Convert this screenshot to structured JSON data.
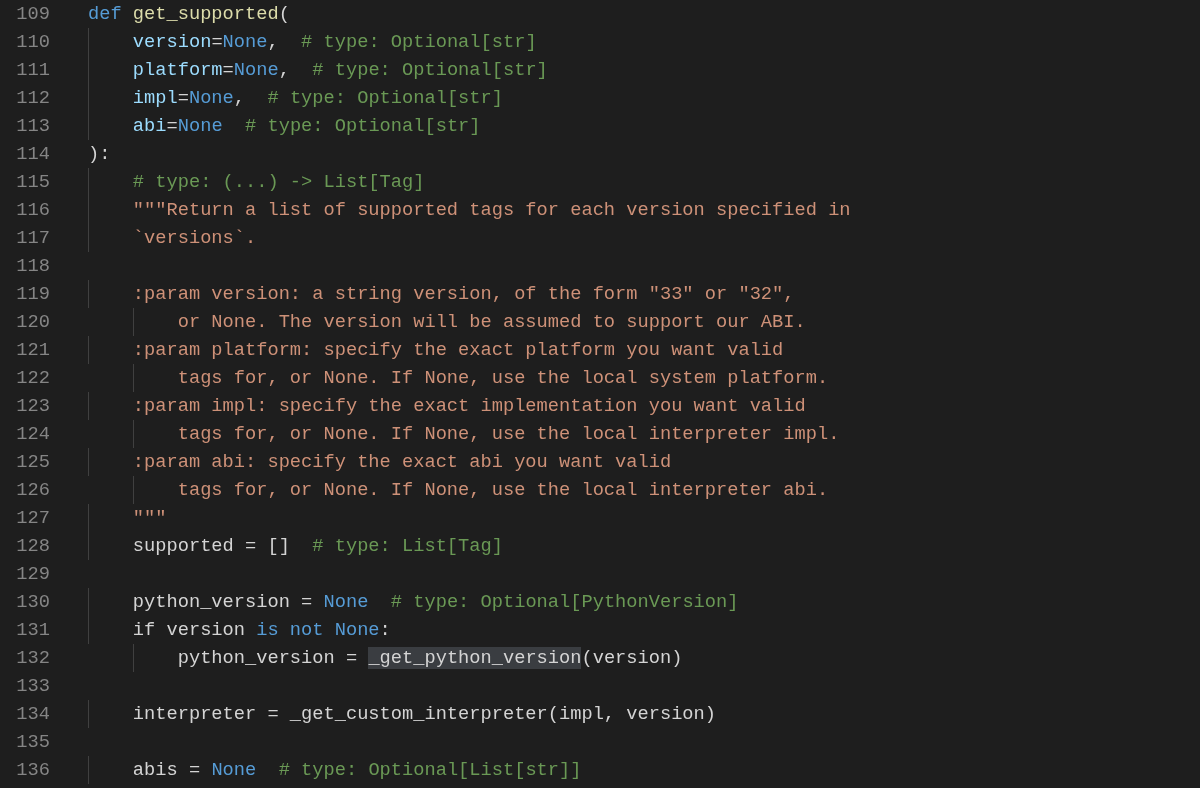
{
  "editor": {
    "lines": [
      {
        "number": "109",
        "tokens": [
          {
            "text": "def ",
            "kind": "keyword"
          },
          {
            "text": "get_supported",
            "kind": "function"
          },
          {
            "text": "(",
            "kind": "plain"
          }
        ]
      },
      {
        "number": "110",
        "tokens": [
          {
            "text": "    version",
            "kind": "parameter"
          },
          {
            "text": "=",
            "kind": "plain"
          },
          {
            "text": "None",
            "kind": "keyword"
          },
          {
            "text": ",  ",
            "kind": "plain"
          },
          {
            "text": "# type: Optional[str]",
            "kind": "comment"
          }
        ]
      },
      {
        "number": "111",
        "tokens": [
          {
            "text": "    platform",
            "kind": "parameter"
          },
          {
            "text": "=",
            "kind": "plain"
          },
          {
            "text": "None",
            "kind": "keyword"
          },
          {
            "text": ",  ",
            "kind": "plain"
          },
          {
            "text": "# type: Optional[str]",
            "kind": "comment"
          }
        ]
      },
      {
        "number": "112",
        "tokens": [
          {
            "text": "    impl",
            "kind": "parameter"
          },
          {
            "text": "=",
            "kind": "plain"
          },
          {
            "text": "None",
            "kind": "keyword"
          },
          {
            "text": ",  ",
            "kind": "plain"
          },
          {
            "text": "# type: Optional[str]",
            "kind": "comment"
          }
        ]
      },
      {
        "number": "113",
        "tokens": [
          {
            "text": "    abi",
            "kind": "parameter"
          },
          {
            "text": "=",
            "kind": "plain"
          },
          {
            "text": "None  ",
            "kind": "keyword"
          },
          {
            "text": "# type: Optional[str]",
            "kind": "comment"
          }
        ]
      },
      {
        "number": "114",
        "tokens": [
          {
            "text": "):",
            "kind": "plain"
          }
        ]
      },
      {
        "number": "115",
        "tokens": [
          {
            "text": "    # type: (...) -> List[Tag]",
            "kind": "comment"
          }
        ]
      },
      {
        "number": "116",
        "tokens": [
          {
            "text": "    \"\"\"Return a list of supported tags for each version specified in",
            "kind": "string"
          }
        ]
      },
      {
        "number": "117",
        "tokens": [
          {
            "text": "    `versions`.",
            "kind": "string"
          }
        ]
      },
      {
        "number": "118"
      },
      {
        "number": "119",
        "tokens": [
          {
            "text": "    :param version: a string version, of the form \"33\" or \"32\",",
            "kind": "string"
          }
        ]
      },
      {
        "number": "120",
        "tokens": [
          {
            "text": "        or None. The version will be assumed to support our ABI.",
            "kind": "string"
          }
        ]
      },
      {
        "number": "121",
        "tokens": [
          {
            "text": "    :param platform: specify the exact platform you want valid",
            "kind": "string"
          }
        ]
      },
      {
        "number": "122",
        "tokens": [
          {
            "text": "        tags for, or None. If None, use the local system platform.",
            "kind": "string"
          }
        ]
      },
      {
        "number": "123",
        "tokens": [
          {
            "text": "    :param impl: specify the exact implementation you want valid",
            "kind": "string"
          }
        ]
      },
      {
        "number": "124",
        "tokens": [
          {
            "text": "        tags for, or None. If None, use the local interpreter impl.",
            "kind": "string"
          }
        ]
      },
      {
        "number": "125",
        "tokens": [
          {
            "text": "    :param abi: specify the exact abi you want valid",
            "kind": "string"
          }
        ]
      },
      {
        "number": "126",
        "tokens": [
          {
            "text": "        tags for, or None. If None, use the local interpreter abi.",
            "kind": "string"
          }
        ]
      },
      {
        "number": "127",
        "tokens": [
          {
            "text": "    \"\"\"",
            "kind": "string"
          }
        ]
      },
      {
        "number": "128",
        "tokens": [
          {
            "text": "    supported = []  ",
            "kind": "plain"
          },
          {
            "text": "# type: List[Tag]",
            "kind": "comment"
          }
        ]
      },
      {
        "number": "129"
      },
      {
        "number": "130",
        "tokens": [
          {
            "text": "    python_version = ",
            "kind": "plain"
          },
          {
            "text": "None  ",
            "kind": "keyword"
          },
          {
            "text": "# type: Optional[PythonVersion]",
            "kind": "comment"
          }
        ]
      },
      {
        "number": "131",
        "tokens": [
          {
            "text": "    if version ",
            "kind": "plain"
          },
          {
            "text": "is not None",
            "kind": "keyword"
          },
          {
            "text": ":",
            "kind": "plain"
          }
        ]
      },
      {
        "number": "132",
        "tokens": [
          {
            "text": "        python_version = ",
            "kind": "plain"
          },
          {
            "text": "_get_python_version",
            "kind": "match"
          },
          {
            "text": "(version)",
            "kind": "plain"
          }
        ]
      },
      {
        "number": "133"
      },
      {
        "number": "134",
        "tokens": [
          {
            "text": "    interpreter = _get_custom_interpreter(impl, version)",
            "kind": "plain"
          }
        ]
      },
      {
        "number": "135"
      },
      {
        "number": "136",
        "tokens": [
          {
            "text": "    abis = ",
            "kind": "plain"
          },
          {
            "text": "None  ",
            "kind": "keyword"
          },
          {
            "text": "# type: Optional[List[str]]",
            "kind": "comment"
          }
        ]
      }
    ]
  }
}
